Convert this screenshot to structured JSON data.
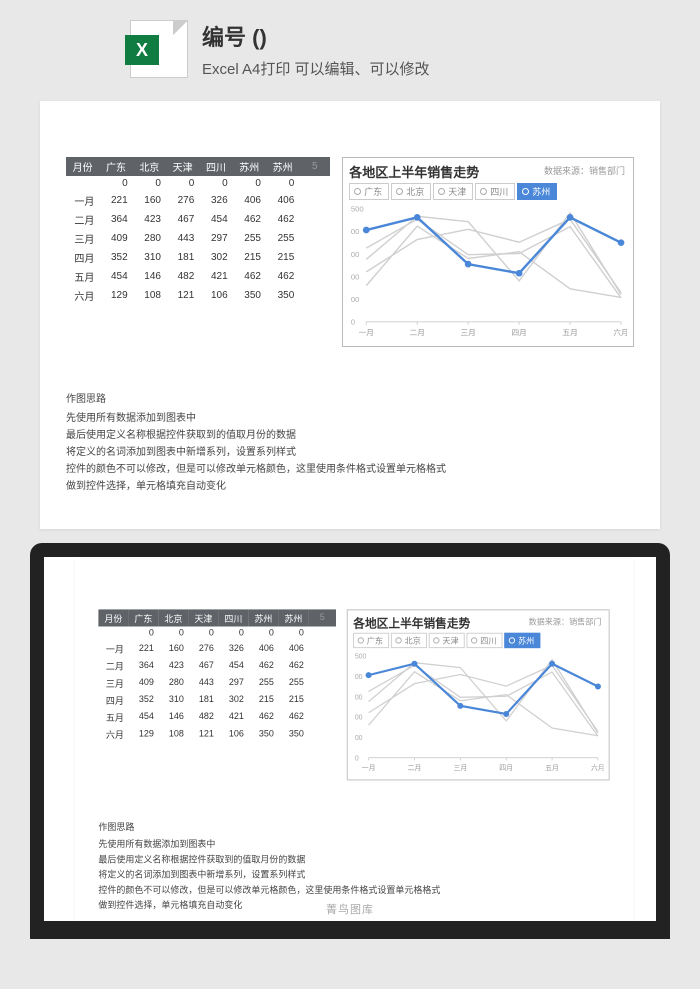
{
  "header": {
    "title": "编号 ()",
    "subtitle": "Excel A4打印 可以编辑、可以修改",
    "icon_letter": "X"
  },
  "table": {
    "headers": [
      "月份",
      "广东",
      "北京",
      "天津",
      "四川",
      "苏州",
      "苏州"
    ],
    "extra_col": "5",
    "zero_row": [
      "",
      "0",
      "0",
      "0",
      "0",
      "0",
      "0"
    ],
    "rows": [
      [
        "一月",
        "221",
        "160",
        "276",
        "326",
        "406",
        "406"
      ],
      [
        "二月",
        "364",
        "423",
        "467",
        "454",
        "462",
        "462"
      ],
      [
        "三月",
        "409",
        "280",
        "443",
        "297",
        "255",
        "255"
      ],
      [
        "四月",
        "352",
        "310",
        "181",
        "302",
        "215",
        "215"
      ],
      [
        "五月",
        "454",
        "146",
        "482",
        "421",
        "462",
        "462"
      ],
      [
        "六月",
        "129",
        "108",
        "121",
        "106",
        "350",
        "350"
      ]
    ]
  },
  "chart": {
    "title": "各地区上半年销售走势",
    "source": "数据来源：销售部门",
    "legend": [
      "广东",
      "北京",
      "天津",
      "四川",
      "苏州"
    ],
    "active_index": 4,
    "x_labels": [
      "一月",
      "二月",
      "三月",
      "四月",
      "五月",
      "六月"
    ],
    "y_ticks": [
      "500",
      "00",
      "00",
      "00",
      "00",
      "0"
    ]
  },
  "chart_data": {
    "type": "line",
    "title": "各地区上半年销售走势",
    "xlabel": "",
    "ylabel": "",
    "categories": [
      "一月",
      "二月",
      "三月",
      "四月",
      "五月",
      "六月"
    ],
    "ylim": [
      0,
      500
    ],
    "highlighted_series": "苏州",
    "series": [
      {
        "name": "广东",
        "values": [
          221,
          364,
          409,
          352,
          454,
          129
        ]
      },
      {
        "name": "北京",
        "values": [
          160,
          423,
          280,
          310,
          146,
          108
        ]
      },
      {
        "name": "天津",
        "values": [
          276,
          467,
          443,
          181,
          482,
          121
        ]
      },
      {
        "name": "四川",
        "values": [
          326,
          454,
          297,
          302,
          421,
          106
        ]
      },
      {
        "name": "苏州",
        "values": [
          406,
          462,
          255,
          215,
          462,
          350
        ]
      }
    ]
  },
  "notes": {
    "title": "作图思路",
    "lines": [
      "先使用所有数据添加到图表中",
      "最后使用定义名称根据控件获取到的值取月份的数据",
      "将定义的名词添加到图表中新增系列，设置系列样式",
      "控件的颜色不可以修改，但是可以修改单元格颜色，这里使用条件格式设置单元格格式",
      "做到控件选择，单元格填充自动变化"
    ]
  },
  "watermark": "菁鸟图库"
}
